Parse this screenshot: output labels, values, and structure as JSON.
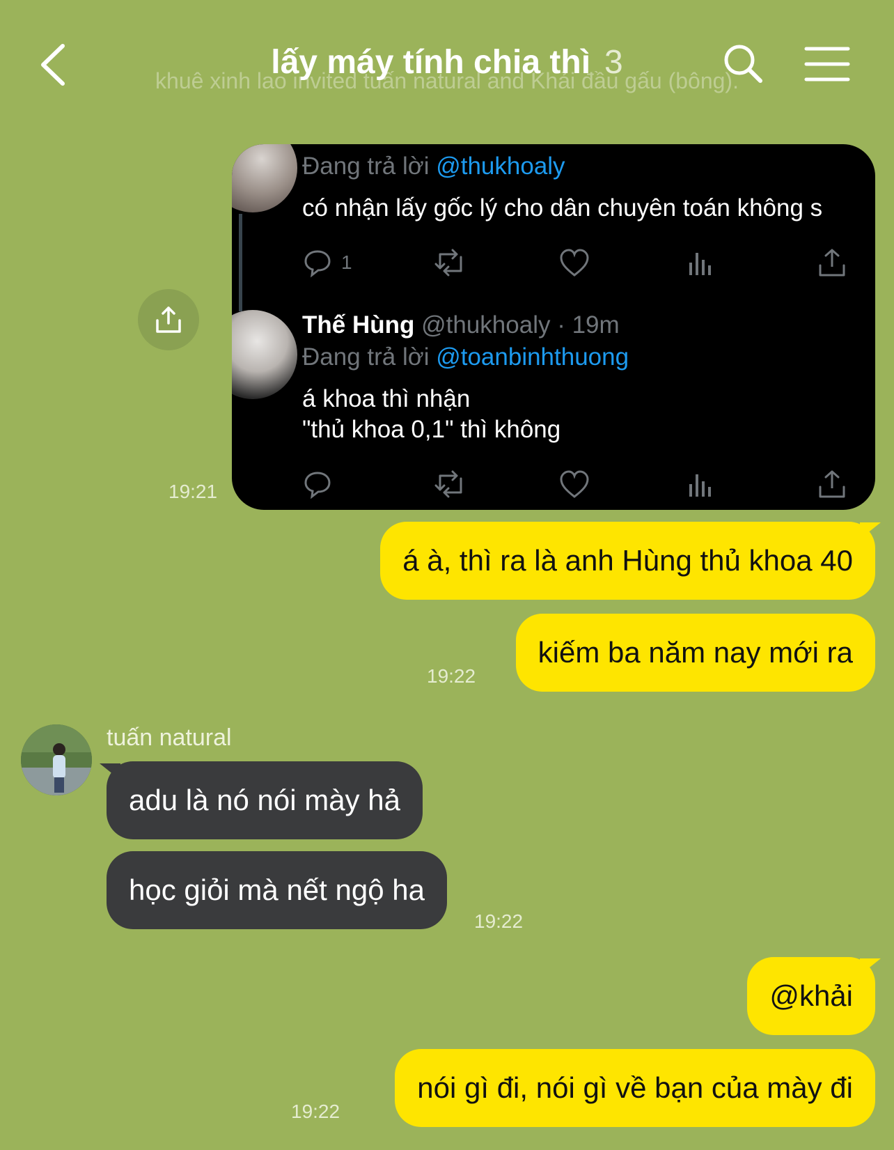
{
  "header": {
    "title": "lấy máy tính chia thì",
    "member_count": "3",
    "system_message": "khuê xinh lao invited tuấn natural and Khải đầu gấu (bông)."
  },
  "tweet": {
    "reply1": {
      "replying_to_label": "Đang trả lời",
      "replying_to_handle": "@thukhoaly",
      "text": "có nhận lấy gốc lý cho dân chuyên toán không s",
      "reply_count": "1"
    },
    "reply2": {
      "name": "Thế Hùng",
      "handle_time": "@thukhoaly · 19m",
      "replying_to_label": "Đang trả lời",
      "replying_to_handle": "@toanbinhthuong",
      "line1": "á khoa thì nhận",
      "line2": "\"thủ khoa 0,1\" thì không"
    },
    "time": "19:21"
  },
  "messages": [
    {
      "side": "mine",
      "text": "á à, thì ra là anh Hùng thủ khoa 40"
    },
    {
      "side": "mine",
      "text": "kiếm ba năm nay mới ra",
      "time": "19:22"
    },
    {
      "side": "theirs",
      "sender": "tuấn natural",
      "text": "adu là nó nói mày hả"
    },
    {
      "side": "theirs",
      "text": "học giỏi mà nết ngộ ha",
      "time": "19:22"
    },
    {
      "side": "mine",
      "text": "@khải"
    },
    {
      "side": "mine",
      "text": "nói gì đi, nói gì về bạn của mày đi",
      "time": "19:22"
    }
  ],
  "colors": {
    "background": "#9bb35a",
    "my_bubble": "#fee500",
    "their_bubble": "#3a3b3d",
    "tweet_link": "#1d9bf0"
  },
  "icons": [
    "back-arrow-icon",
    "search-icon",
    "menu-icon",
    "share-icon",
    "reply-icon",
    "retweet-icon",
    "like-icon",
    "views-icon",
    "tweet-share-icon"
  ]
}
